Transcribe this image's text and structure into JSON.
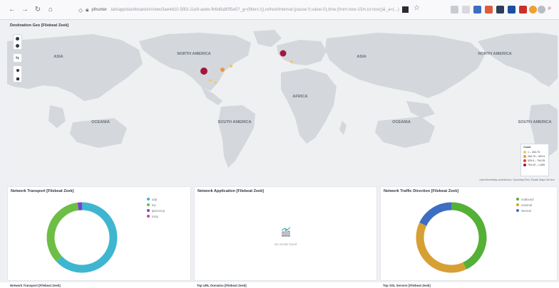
{
  "browser": {
    "url_host": "pihunter",
    "url_rest": ".lab/app/dashboards#/view/3ae4d10-5f83-11e9-aebe-fb6d8a90f5e5?_g=(filters:!(),refreshInterval:(pause:!t,value:0),time:(from:now-15m,to:now))&_a=(...)"
  },
  "map": {
    "title": "Destination Geo [Filebeat Zeek]",
    "continents": {
      "asia_left": "ASIA",
      "north_america": "NORTH AMERICA",
      "asia_right": "ASIA",
      "north_america_right": "NORTH AMERICA",
      "africa": "AFRICA",
      "oceania_left": "OCEANIA",
      "south_america": "SOUTH AMERICA",
      "oceania_right": "OCEANIA",
      "south_america_right": "SOUTH AMERICA"
    },
    "legend": {
      "title": "Count",
      "items": [
        {
          "label": "1 – 264.75",
          "color": "#f3c853"
        },
        {
          "label": "264.75 – 529.5",
          "color": "#f39244"
        },
        {
          "label": "529.5 – 794.25",
          "color": "#e0412b"
        },
        {
          "label": "794.25 – 1,059",
          "color": "#a1163c"
        }
      ]
    },
    "attribution": "OpenStreetMap contributors, OpenMapTiles, Elastic Maps Service"
  },
  "panels": {
    "transport": {
      "title": "Network Transport [Filebeat Zeek]",
      "legend": [
        "udp",
        "tcp",
        "ipv6-icmp",
        "icmp"
      ],
      "colors": [
        "#3eb6d0",
        "#6dbe45",
        "#7d3fd0",
        "#d63baf"
      ]
    },
    "application": {
      "title": "Network Application [Filebeat Zeek]",
      "no_results": "No results found"
    },
    "direction": {
      "title": "Network Traffic Direction [Filebeat Zeek]",
      "legend": [
        "outbound",
        "external",
        "internal"
      ],
      "colors": [
        "#54b037",
        "#d6a034",
        "#3d6ec2"
      ]
    }
  },
  "bottom_titles": [
    "Network Transport [Filebeat Zeek]",
    "Top URL Domains [Filebeat Zeek]",
    "Top SSL Servers [Filebeat Zeek]"
  ],
  "chart_data": [
    {
      "type": "pie",
      "title": "Network Transport [Filebeat Zeek]",
      "categories": [
        "udp",
        "tcp",
        "ipv6-icmp",
        "icmp"
      ],
      "values": [
        63,
        35,
        2,
        0
      ]
    },
    {
      "type": "pie",
      "title": "Network Traffic Direction [Filebeat Zeek]",
      "categories": [
        "outbound",
        "external",
        "internal"
      ],
      "values": [
        43,
        39,
        18
      ]
    }
  ]
}
